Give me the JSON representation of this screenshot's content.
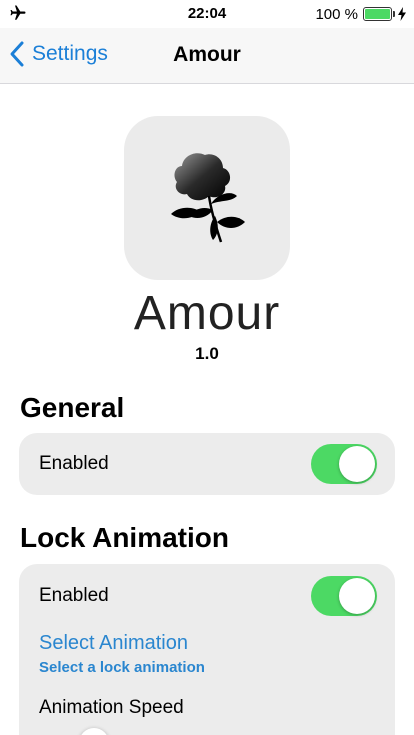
{
  "status_bar": {
    "time": "22:04",
    "battery_percent": "100 %",
    "battery_level": 1.0,
    "battery_color": "#4cd964",
    "icons": [
      "airplane-icon",
      "battery-icon",
      "charging-bolt-icon"
    ]
  },
  "nav": {
    "back_label": "Settings",
    "title": "Amour",
    "accent": "#1b7fd7"
  },
  "header": {
    "app_name": "Amour",
    "version": "1.0",
    "icon": "rose-icon"
  },
  "sections": {
    "general": {
      "title": "General",
      "enabled_label": "Enabled",
      "enabled": true
    },
    "lock_animation": {
      "title": "Lock Animation",
      "enabled_label": "Enabled",
      "enabled": true,
      "select_title": "Select Animation",
      "select_subtitle": "Select a lock animation",
      "speed_label": "Animation Speed"
    }
  },
  "toggle_on_color": "#4cd964",
  "link_color": "#2a86cf"
}
